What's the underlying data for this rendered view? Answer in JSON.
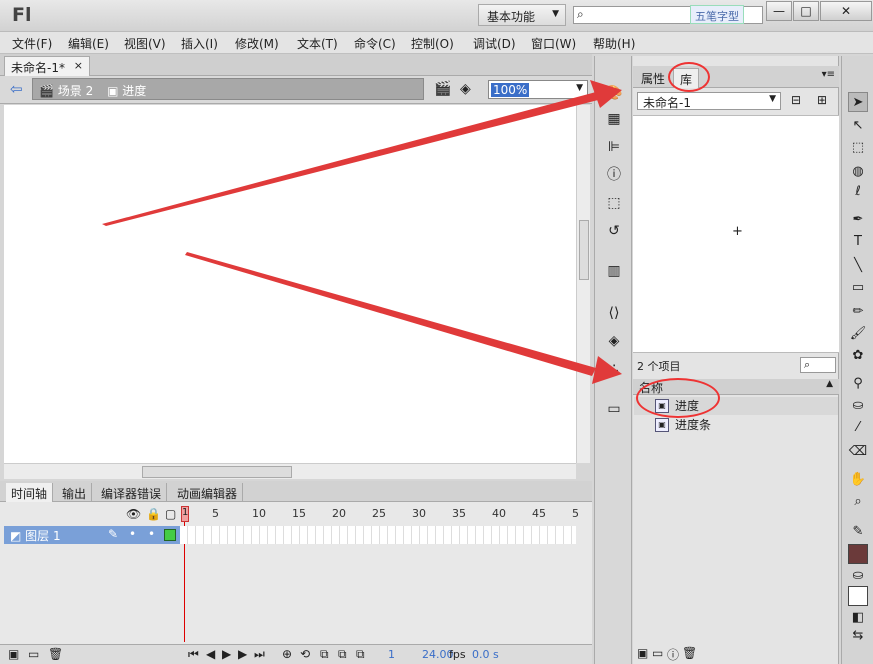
{
  "app": {
    "logo": "Fl",
    "workspace": "基本功能",
    "watermark": "五笔字型"
  },
  "window_buttons": {
    "min": "—",
    "max": "□",
    "close": "✕"
  },
  "menu": [
    "文件(F)",
    "编辑(E)",
    "视图(V)",
    "插入(I)",
    "修改(M)",
    "文本(T)",
    "命令(C)",
    "控制(O)",
    "调试(D)",
    "窗口(W)",
    "帮助(H)"
  ],
  "document": {
    "tab": "未命名-1*",
    "close": "×",
    "scene": "场景 2",
    "symbol": "进度",
    "zoom": "100%"
  },
  "timeline": {
    "tabs": [
      "时间轴",
      "输出",
      "编译器错误",
      "动画编辑器"
    ],
    "layer": "图层 1",
    "frame_numbers": [
      "1",
      "5",
      "10",
      "15",
      "20",
      "25",
      "30",
      "35",
      "40",
      "45",
      "5"
    ],
    "current_frame": "1",
    "fps": "24.00",
    "fps_unit": "fps",
    "time": "0.0 s"
  },
  "library": {
    "tabs": [
      "属性",
      "库"
    ],
    "doc": "未命名-1",
    "count": "2 个项目",
    "header": "名称",
    "items": [
      "进度",
      "进度条"
    ]
  },
  "colors": {
    "accent": "#3a6ec8",
    "arrow": "#e03a3a",
    "layer": "#7aa0d8"
  }
}
